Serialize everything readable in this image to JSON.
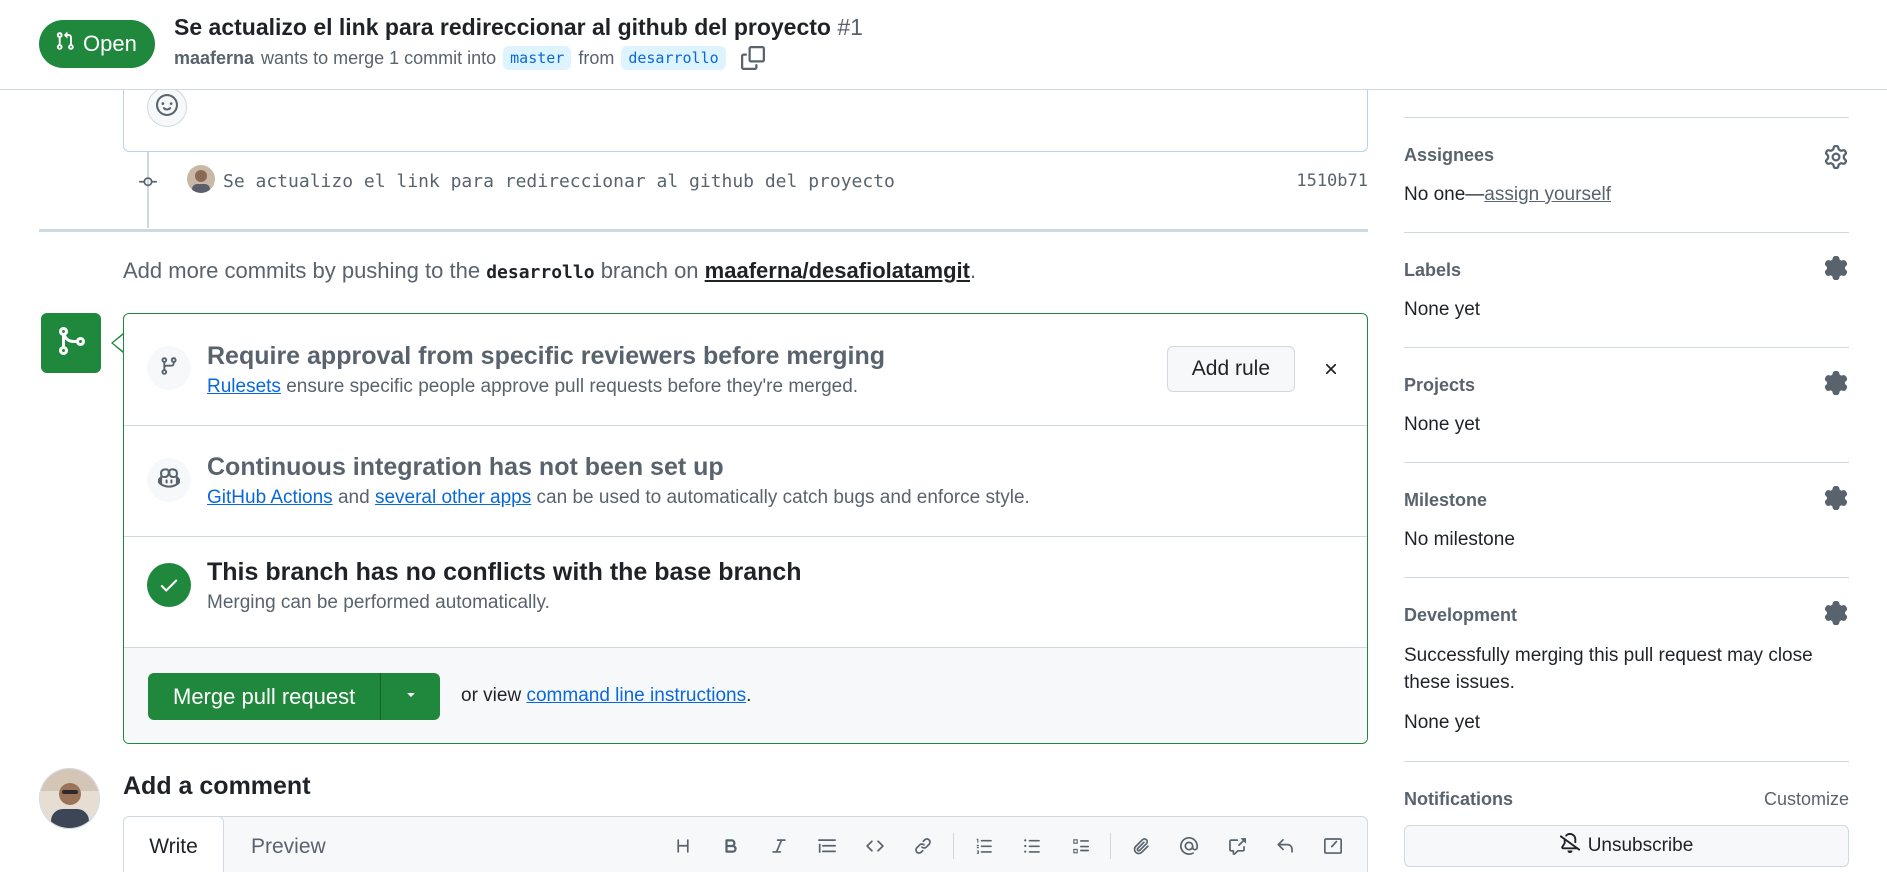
{
  "header": {
    "state": "Open",
    "title": "Se actualizo el link para redireccionar al github del proyecto",
    "number": "#1",
    "author": "maaferna",
    "merge_text": "wants to merge 1 commit into",
    "base_branch": "master",
    "from_text": "from",
    "head_branch": "desarrollo",
    "copy_icon": "copy-icon"
  },
  "timeline": {
    "commit_message": "Se actualizo el link para redireccionar al github del proyecto",
    "commit_sha": "1510b71",
    "push_hint_prefix": "Add more commits by pushing to the",
    "push_hint_branch": "desarrollo",
    "push_hint_middle": "branch on",
    "push_hint_repo": "maaferna/desafiolatamgit",
    "push_hint_suffix": "."
  },
  "merge_box": {
    "reviewers": {
      "title": "Require approval from specific reviewers before merging",
      "link": "Rulesets",
      "desc": "ensure specific people approve pull requests before they're merged.",
      "button": "Add rule"
    },
    "ci": {
      "title": "Continuous integration has not been set up",
      "link1": "GitHub Actions",
      "and": "and",
      "link2": "several other apps",
      "desc": "can be used to automatically catch bugs and enforce style."
    },
    "conflicts": {
      "title": "This branch has no conflicts with the base branch",
      "desc": "Merging can be performed automatically."
    },
    "merge_button": "Merge pull request",
    "or_view": "or view",
    "cli_link": "command line instructions",
    "cli_suffix": "."
  },
  "comment": {
    "title": "Add a comment",
    "tab_write": "Write",
    "tab_preview": "Preview",
    "toolbar_icons": [
      "heading-icon",
      "bold-icon",
      "italic-icon",
      "quote-icon",
      "code-icon",
      "link-icon",
      "ordered-list-icon",
      "unordered-list-icon",
      "task-list-icon",
      "attach-icon",
      "mention-icon",
      "cross-reference-icon",
      "reply-icon",
      "slash-command-icon"
    ]
  },
  "sidebar": {
    "assignees": {
      "heading": "Assignees",
      "value_prefix": "No one—",
      "value_link": "assign yourself"
    },
    "labels": {
      "heading": "Labels",
      "value": "None yet"
    },
    "projects": {
      "heading": "Projects",
      "value": "None yet"
    },
    "milestone": {
      "heading": "Milestone",
      "value": "No milestone"
    },
    "development": {
      "heading": "Development",
      "desc": "Successfully merging this pull request may close these issues.",
      "value": "None yet"
    },
    "notifications": {
      "heading": "Notifications",
      "customize": "Customize",
      "button": "Unsubscribe"
    }
  },
  "colors": {
    "green": "#1f883d",
    "link": "#0969da",
    "muted": "#59636e",
    "border": "#d1d9e0"
  }
}
